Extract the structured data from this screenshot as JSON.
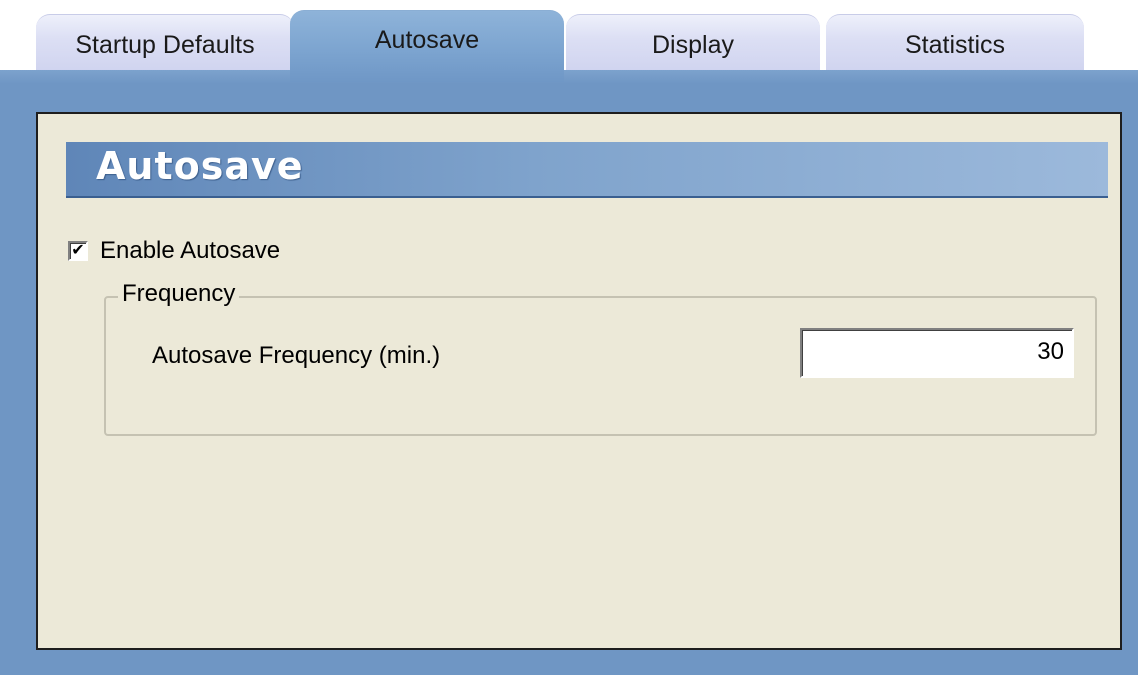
{
  "tabs": [
    {
      "label": "Startup Defaults",
      "active": false
    },
    {
      "label": "Autosave",
      "active": true
    },
    {
      "label": "Display",
      "active": false
    },
    {
      "label": "Statistics",
      "active": false
    }
  ],
  "panel": {
    "title": "Autosave",
    "enable_autosave": {
      "label": "Enable Autosave",
      "checked": true,
      "check_mark": "✔"
    },
    "frequency_group": {
      "legend": "Frequency",
      "field_label": "Autosave Frequency (min.)",
      "field_value": "30"
    }
  },
  "colors": {
    "frame": "#6f96c4",
    "content_bg": "#ece9d8",
    "active_tab": "#7ba3cf",
    "inactive_tab": "#dcdff4"
  }
}
